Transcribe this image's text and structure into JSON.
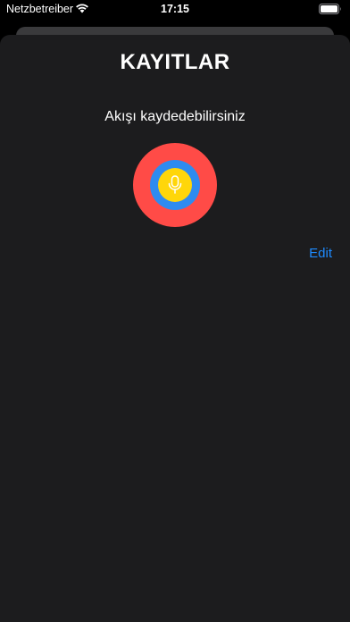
{
  "status_bar": {
    "carrier": "Netzbetreiber",
    "time": "17:15",
    "wifi_icon": "wifi-icon",
    "battery_icon": "battery-icon"
  },
  "header": {
    "title": "KAYITLAR"
  },
  "main": {
    "subtitle": "Akışı kaydedebilirsiniz",
    "record_button": {
      "icon": "microphone-icon",
      "colors": {
        "outer": "#ff4b47",
        "ring": "#2e8bf0",
        "core": "#ffd60a"
      }
    },
    "edit_label": "Edit"
  },
  "colors": {
    "background": "#1c1c1e",
    "accent": "#1e8bff"
  }
}
